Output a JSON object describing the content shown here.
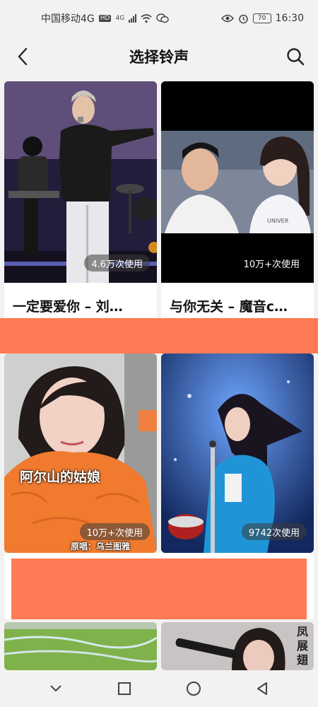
{
  "status_bar": {
    "carrier": "中国移动4G",
    "hd": "HD",
    "net": "4G",
    "battery": "70",
    "time": "16:30"
  },
  "header": {
    "title": "选择铃声",
    "back_icon": "back-arrow-icon",
    "search_icon": "search-icon"
  },
  "cards": [
    {
      "title": "一定要爱你 – 刘…",
      "usage": "4.6万次使用"
    },
    {
      "title": "与你无关 – 魔音c…",
      "usage": "10万+次使用"
    },
    {
      "title": "",
      "usage": "10万+次使用",
      "overlay_title": "阿尔山的姑娘",
      "overlay_sub": "原唱：乌兰图雅"
    },
    {
      "title": "",
      "usage": "9742次使用"
    },
    {
      "title": "",
      "usage": ""
    },
    {
      "title": "",
      "usage": "",
      "overlay_text": "凤展翅"
    }
  ],
  "colors": {
    "banner": "#ff7a55",
    "background": "#f2f2f2"
  },
  "nav_bar": {
    "icons": [
      "chevron-down-icon",
      "recent-apps-icon",
      "home-icon",
      "back-triangle-icon"
    ]
  }
}
